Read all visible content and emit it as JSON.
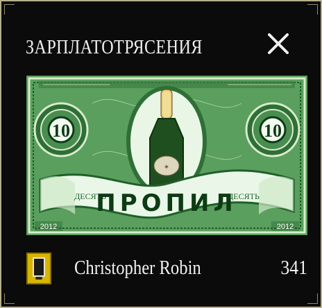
{
  "dialog": {
    "title": "ЗАРПЛАТОТРЯСЕНИЯ",
    "close_icon": "close-icon"
  },
  "banknote": {
    "denomination_left": "10",
    "denomination_right": "10",
    "banner_text": "ПРОПИЛ",
    "ribbon_left": "ДЕСЯТЬ",
    "ribbon_right": "ДЕСЯТЬ",
    "year_left": "2012",
    "year_right": "2012",
    "center_image": "champagne-bottle",
    "colors": {
      "note_green": "#5a9f5d",
      "note_dark": "#1f5f2a",
      "note_light": "#d8eccc",
      "background": "#0b0b0b",
      "text": "#f1f1f1",
      "border": "#b7b08a",
      "icon_gold": "#d7b500"
    }
  },
  "leaderboard": {
    "rows": [
      {
        "name": "Christopher Robin",
        "score": "341",
        "icon": "phone-icon"
      }
    ]
  }
}
